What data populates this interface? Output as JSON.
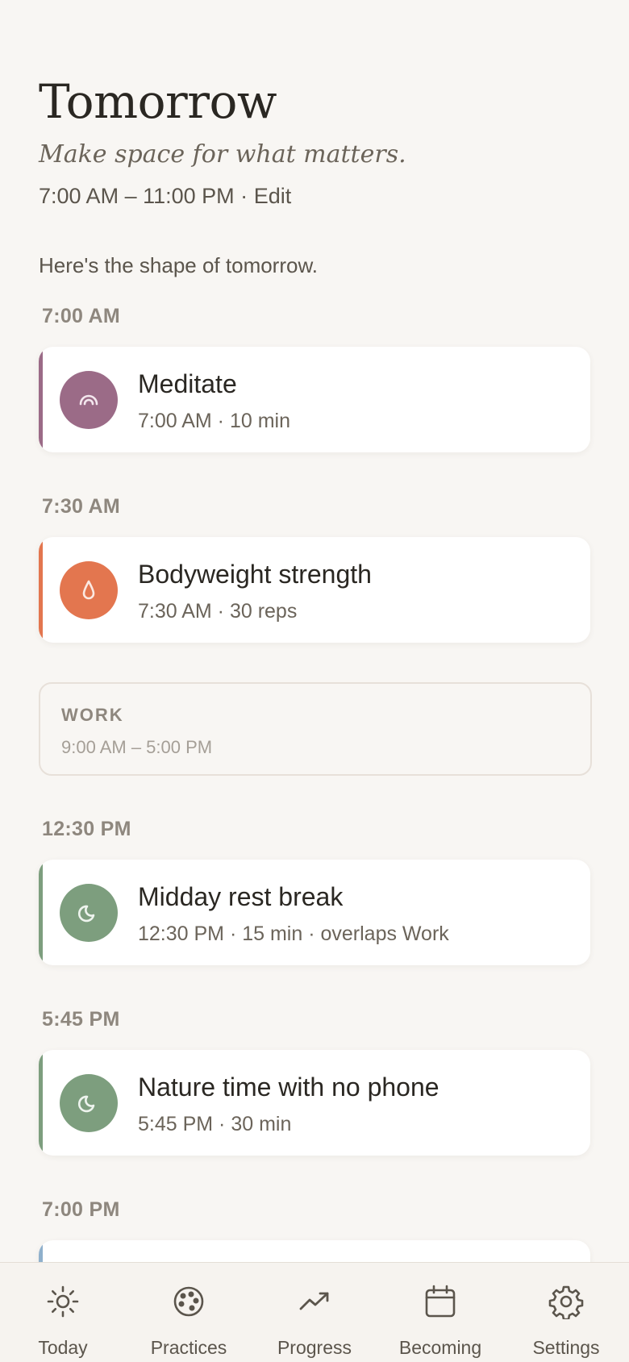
{
  "header": {
    "title": "Tomorrow",
    "tagline": "Make space for what matters.",
    "hours": "7:00 AM – 11:00 PM",
    "separator": "·",
    "edit_label": "Edit",
    "intro": "Here's the shape of tomorrow."
  },
  "schedule": {
    "slots": [
      {
        "time": "7:00 AM",
        "name": "Meditate",
        "meta": "7:00 AM · 10 min",
        "color": "#9b6b87",
        "icon": "rainbow-icon"
      },
      {
        "time": "7:30 AM",
        "name": "Bodyweight strength",
        "meta": "7:30 AM · 30 reps",
        "color": "#e3764f",
        "icon": "droplet-icon"
      },
      {
        "time": "12:30 PM",
        "name": "Midday rest break",
        "meta": "12:30 PM · 15 min · overlaps Work",
        "color": "#7d9e7e",
        "icon": "moon-icon"
      },
      {
        "time": "5:45 PM",
        "name": "Nature time with no phone",
        "meta": "5:45 PM · 30 min",
        "color": "#7d9e7e",
        "icon": "moon-icon"
      },
      {
        "time": "7:00 PM",
        "color": "#8fb0cc"
      }
    ],
    "work_block": {
      "label": "WORK",
      "time": "9:00 AM – 5:00 PM"
    }
  },
  "tabs": [
    {
      "label": "Today",
      "icon": "sun-icon"
    },
    {
      "label": "Practices",
      "icon": "palette-icon"
    },
    {
      "label": "Progress",
      "icon": "trend-up-icon"
    },
    {
      "label": "Becoming",
      "icon": "calendar-icon"
    },
    {
      "label": "Settings",
      "icon": "gear-icon"
    }
  ]
}
